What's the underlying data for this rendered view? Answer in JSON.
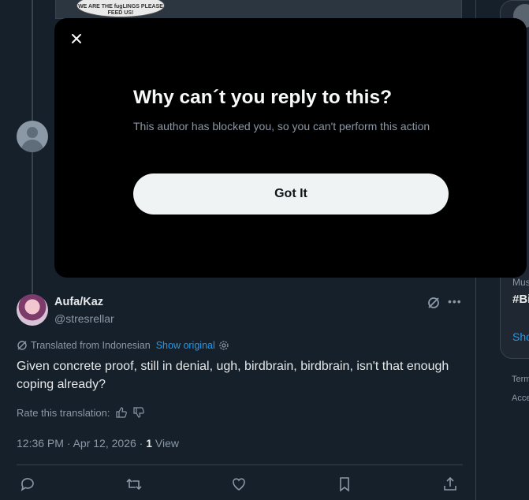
{
  "background": {
    "sticker_text": "WE ARE THE fugLINGS PLEASE FEED US!"
  },
  "modal": {
    "title": "Why can´t you reply to this?",
    "description": "This author has blocked you, so you can't perform this action",
    "button_label": "Got It",
    "close_icon": "close-icon"
  },
  "tweet": {
    "display_name": "Aufa/Kaz",
    "handle": "@stresrellar",
    "translated_label": "Translated from Indonesian",
    "show_original": "Show original",
    "text": "Given concrete proof, still in denial, ugh, birdbrain, birdbrain, isn't that enough coping already?",
    "rate_label": "Rate this translation:",
    "time": "12:36 PM · Apr 12, 2026 ·",
    "view_count": "1",
    "view_label": "View",
    "actions": [
      "reply-icon",
      "retweet-icon",
      "like-icon",
      "bookmark-icon",
      "share-icon"
    ]
  },
  "right_column": {
    "text_mus": "Mus",
    "hashtag": "#Bi",
    "show_link": "Sho",
    "terms": "Term",
    "access": "Acce"
  },
  "colors": {
    "background": "#15202b",
    "modal": "#000000",
    "accent": "#1d9bf0",
    "button": "#eff3f4",
    "muted": "#8b98a5"
  }
}
